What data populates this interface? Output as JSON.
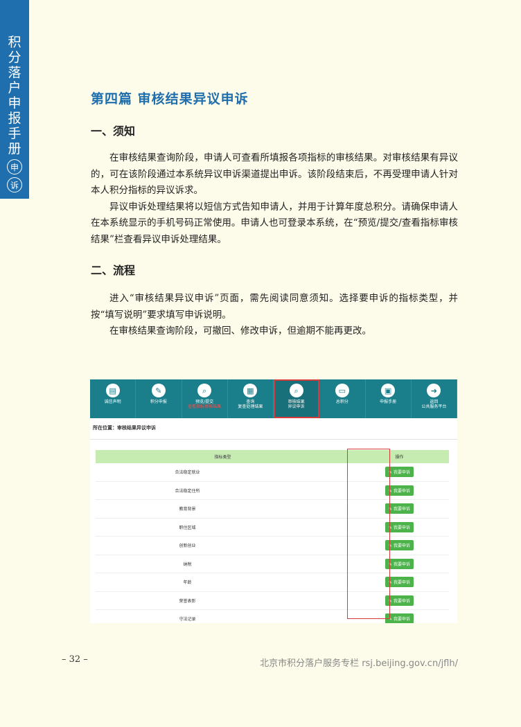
{
  "side_tab": {
    "title": "积分落户申报手册",
    "badge1": "申",
    "badge2": "诉"
  },
  "chapter_title": "第四篇 审核结果异议申诉",
  "section1": {
    "heading": "一、须知",
    "p1": "在审核结果查询阶段，申请人可查看所填报各项指标的审核结果。对审核结果有异议的，可在该阶段通过本系统异议申诉渠道提出申诉。该阶段结束后，不再受理申请人针对本人积分指标的异议诉求。",
    "p2": "异议申诉处理结果将以短信方式告知申请人，并用于计算年度总积分。请确保申请人在本系统显示的手机号码正常使用。申请人也可登录本系统，在“预览/提交/查看指标审核结果”栏查看异议申诉处理结果。"
  },
  "section2": {
    "heading": "二、流程",
    "p1": "进入“审核结果异议申诉”页面，需先阅读同意须知。选择要申诉的指标类型，并按“填写说明”要求填写申诉说明。",
    "p2": "在审核结果查询阶段，可撤回、修改申诉，但逾期不能再更改。"
  },
  "screenshot": {
    "nav": [
      {
        "l1": "诚信声明",
        "l2": "",
        "icon": "▤"
      },
      {
        "l1": "积分申报",
        "l2": "",
        "icon": "✎"
      },
      {
        "l1": "预览/提交",
        "l2": "查看指标审核结果",
        "icon": "⌕"
      },
      {
        "l1": "查询",
        "l2": "复查处理结果",
        "icon": "▦"
      },
      {
        "l1": "审核结果",
        "l2": "异议申诉",
        "icon": "⌕"
      },
      {
        "l1": "总积分",
        "l2": "",
        "icon": "▭"
      },
      {
        "l1": "申报手册",
        "l2": "",
        "icon": "▣"
      },
      {
        "l1": "返回",
        "l2": "公共服务平台",
        "icon": "➜"
      }
    ],
    "location": "所在位置：审核结果异议申诉",
    "col1": "指标类型",
    "col2": "操作",
    "button": "我要申诉",
    "rows": [
      "合法稳定就业",
      "合法稳定住所",
      "教育背景",
      "职住区域",
      "创新创业",
      "纳税",
      "年龄",
      "荣誉表彰",
      "守法记录"
    ]
  },
  "page_number": "– 32 –",
  "footer": "北京市积分落户服务专栏 rsj.beijing.gov.cn/jflh/"
}
